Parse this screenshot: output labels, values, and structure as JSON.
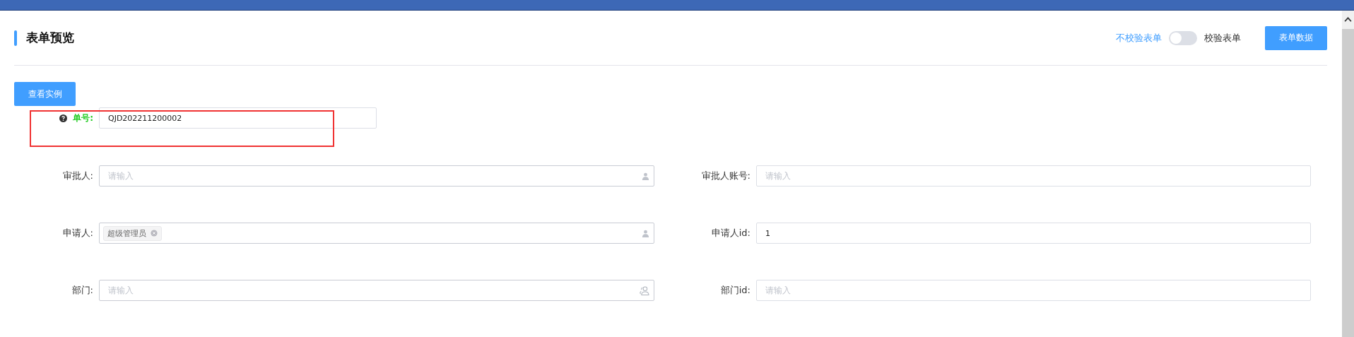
{
  "page": {
    "title": "表单预览"
  },
  "validation": {
    "off_label": "不校验表单",
    "on_label": "校验表单",
    "on": false
  },
  "buttons": {
    "form_data": "表单数据",
    "view_example": "查看实例"
  },
  "order_no": {
    "label": "单号:",
    "help": true,
    "value": "QJD202211200002",
    "highlighted": true
  },
  "rows": [
    [
      {
        "label": "审批人:",
        "kind": "user",
        "placeholder": "请输入"
      },
      {
        "label": "审批人账号:",
        "kind": "text",
        "placeholder": "请输入"
      }
    ],
    [
      {
        "label": "申请人:",
        "kind": "user",
        "tags": [
          "超级管理员"
        ]
      },
      {
        "label": "申请人id:",
        "kind": "text",
        "value": "1"
      }
    ],
    [
      {
        "label": "部门:",
        "kind": "dept",
        "placeholder": "请输入"
      },
      {
        "label": "部门id:",
        "kind": "text",
        "placeholder": "请输入"
      }
    ]
  ]
}
